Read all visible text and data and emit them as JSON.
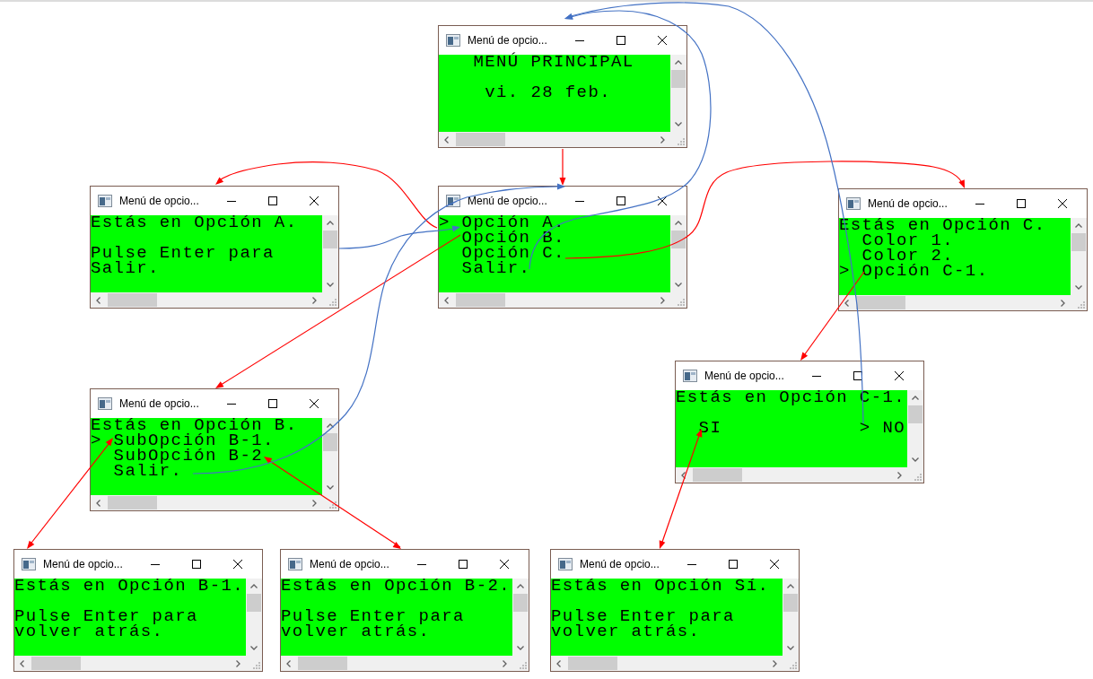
{
  "windows": [
    {
      "title": "Menú de opcio...",
      "kind": "banner",
      "heading": "MENÚ PRINCIPAL",
      "date": "vi. 28 feb."
    },
    {
      "title": "Menú de opcio...",
      "kind": "message",
      "heading": "Estás en Opción A.",
      "message": "Pulse Enter para Salir."
    },
    {
      "title": "Menú de opcio...",
      "kind": "menu",
      "cursor": ">",
      "items": [
        {
          "label": "Opción A.",
          "selected": true
        },
        {
          "label": "Opción B.",
          "selected": false
        },
        {
          "label": "Opción C.",
          "selected": false
        },
        {
          "label": "Salir.",
          "selected": false
        }
      ]
    },
    {
      "title": "Menú de opcio...",
      "kind": "menu",
      "heading": "Estás en Opción C.",
      "cursor": ">",
      "items": [
        {
          "label": "Color 1.",
          "selected": false
        },
        {
          "label": "Color 2.",
          "selected": false
        },
        {
          "label": "Opción C-1.",
          "selected": true
        }
      ]
    },
    {
      "title": "Menú de opcio...",
      "kind": "choice",
      "heading": "Estás en Opción C-1.",
      "cursor": ">",
      "options": [
        {
          "label": "SI",
          "selected": false
        },
        {
          "label": "NO",
          "selected": true
        }
      ]
    },
    {
      "title": "Menú de opcio...",
      "kind": "menu",
      "heading": "Estás en Opción B.",
      "cursor": ">",
      "items": [
        {
          "label": "SubOpción B-1.",
          "selected": true
        },
        {
          "label": "SubOpción B-2",
          "selected": false
        },
        {
          "label": "Salir.",
          "selected": false
        }
      ]
    },
    {
      "title": "Menú de opcio...",
      "kind": "message",
      "heading": "Estás en Opción B-1.",
      "message": "Pulse Enter para volver atrás."
    },
    {
      "title": "Menú de opcio...",
      "kind": "message",
      "heading": "Estás en Opción B-2.",
      "message": "Pulse Enter para volver atrás."
    },
    {
      "title": "Menú de opcio...",
      "kind": "message",
      "heading": "Estás en Opción Sí.",
      "message": "Pulse Enter para volver atrás."
    }
  ]
}
